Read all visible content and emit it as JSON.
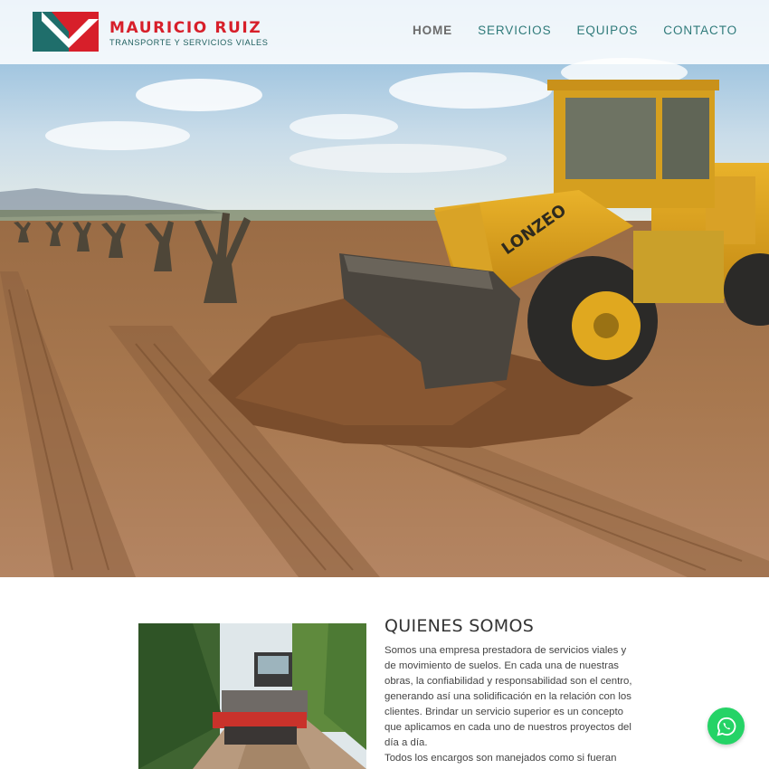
{
  "brand": {
    "name": "MAURICIO RUIZ",
    "tagline": "TRANSPORTE Y SERVICIOS VIALES",
    "logo_colors": {
      "teal": "#1f6e6b",
      "red": "#d71f2a"
    }
  },
  "nav": {
    "items": [
      {
        "label": "HOME",
        "active": true
      },
      {
        "label": "SERVICIOS",
        "active": false
      },
      {
        "label": "EQUIPOS",
        "active": false
      },
      {
        "label": "CONTACTO",
        "active": false
      }
    ]
  },
  "hero": {
    "loader_model_text": "LONZEO"
  },
  "about": {
    "title": "QUIENES SOMOS",
    "paragraph1": "Somos una empresa prestadora de servicios viales y de movimiento de suelos. En cada una de nuestras obras, la confiabilidad y responsabilidad son el centro, generando así una solidificación en la relación con los clientes. Brindar un servicio superior es un concepto que aplicamos en cada uno de nuestros proyectos del día a día.",
    "paragraph2": "Todos los encargos son manejados como si fueran"
  },
  "widgets": {
    "whatsapp_icon": "whatsapp-icon",
    "whatsapp_color": "#25d366"
  }
}
